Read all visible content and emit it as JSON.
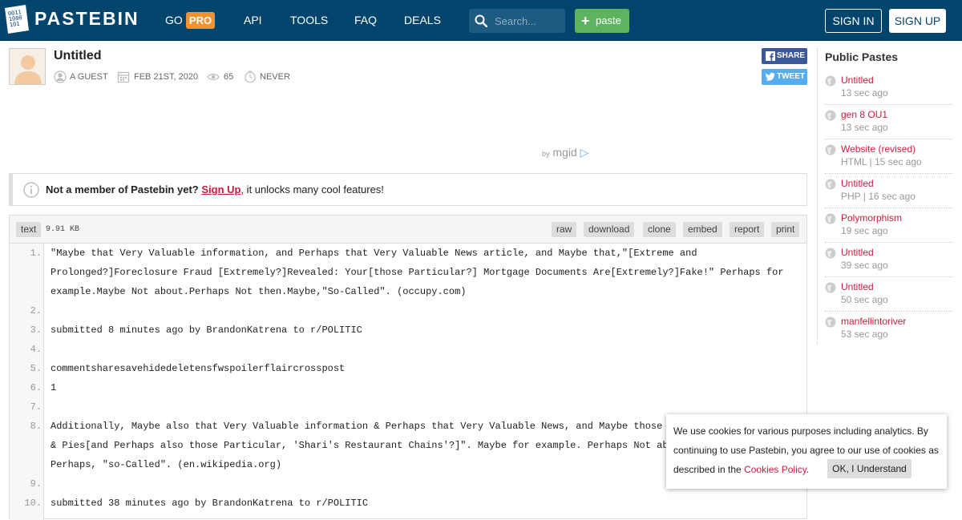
{
  "header": {
    "logo_text": "PASTEBIN",
    "nav": {
      "go": "GO",
      "pro": "PRO",
      "api": "API",
      "tools": "TOOLS",
      "faq": "FAQ",
      "deals": "DEALS"
    },
    "search_placeholder": "Search...",
    "paste_label": "paste",
    "sign_in": "SIGN IN",
    "sign_up": "SIGN UP"
  },
  "paste": {
    "title": "Untitled",
    "author": "A GUEST",
    "date": "FEB 21ST, 2020",
    "views": "65",
    "expiry": "NEVER",
    "share": "SHARE",
    "tweet": "TWEET"
  },
  "ad": {
    "by": "by",
    "brand": "mgid"
  },
  "notice": {
    "bold": "Not a member of Pastebin yet?",
    "link": "Sign Up",
    "rest": ", it unlocks many cool features!"
  },
  "code": {
    "syntax": "text",
    "size": "9.91 KB",
    "actions": [
      "raw",
      "download",
      "clone",
      "embed",
      "report",
      "print"
    ],
    "line_numbers": [
      "1.",
      "2.",
      "3.",
      "4.",
      "5.",
      "6.",
      "7.",
      "8.",
      "9.",
      "10."
    ],
    "lines": [
      "\"Maybe that Very Valuable information, and Perhaps that Very Valuable News article, and Maybe that,\"[Extreme and",
      "Prolonged?]Foreclosure Fraud [Extremely?]Revealed: Your[those Particular?] Mortgage Documents Are[Extremely?]Fake!\" Perhaps for",
      "example.Maybe Not about.Perhaps Not then.Maybe,\"So-Called\". (occupy.com)",
      "",
      "submitted 8 minutes ago by BrandonKatrena to r/POLITIC",
      "",
      "commentsharesavehidedeletensfwspoilerflaircrosspost",
      "1",
      "",
      "Additionally, Maybe also that Very Valuable information & Perhaps that Very Valuable News, and Maybe those Par",
      "& Pies[and Perhaps also those Particular, 'Shari's Restaurant Chains'?]\". Maybe for example. Perhaps Not about",
      "Perhaps, \"so-Called\". (en.wikipedia.org)",
      "",
      "submitted 38 minutes ago by BrandonKatrena to r/POLITIC"
    ]
  },
  "sidebar": {
    "title": "Public Pastes",
    "items": [
      {
        "name": "Untitled",
        "meta": "13 sec ago"
      },
      {
        "name": "gen 8 OU1",
        "meta": "13 sec ago"
      },
      {
        "name": "Website (revised)",
        "meta": "HTML | 15 sec ago"
      },
      {
        "name": "Untitled",
        "meta": "PHP | 16 sec ago"
      },
      {
        "name": "Polymorphism",
        "meta": "19 sec ago"
      },
      {
        "name": "Untitled",
        "meta": "39 sec ago"
      },
      {
        "name": "Untitled",
        "meta": "50 sec ago"
      },
      {
        "name": "manfellintoriver",
        "meta": "53 sec ago"
      }
    ]
  },
  "cookie": {
    "text": "We use cookies for various purposes including analytics. By continuing to use Pastebin, you agree to our use of cookies as described in the ",
    "link": "Cookies Policy",
    "after": ".",
    "ok": "OK, I Understand"
  },
  "colors": {
    "header_bg": "#02456c",
    "pro": "#f3912f",
    "paste_btn": "#5eb45e",
    "link": "#c71c3f"
  }
}
